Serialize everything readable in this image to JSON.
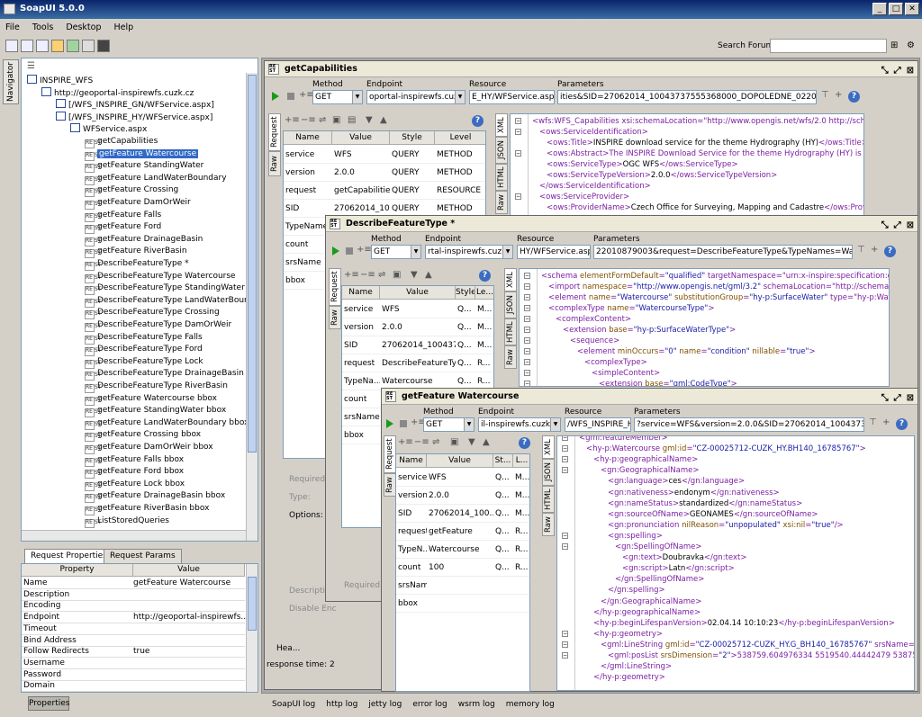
{
  "app": {
    "title": "SoapUI 5.0.0"
  },
  "menu": [
    "File",
    "Tools",
    "Desktop",
    "Help"
  ],
  "search": {
    "label": "Search Forum",
    "placeholder": ""
  },
  "navigator": {
    "tab_label": "Navigator"
  },
  "tree": [
    {
      "label": "INSPIRE_WFS",
      "indent": 0,
      "icon": "project-icon"
    },
    {
      "label": "http://geoportal-inspirewfs.cuzk.cz",
      "indent": 1,
      "icon": "interface-icon"
    },
    {
      "label": "[/WFS_INSPIRE_GN/WFService.aspx]",
      "indent": 2,
      "icon": "resource-icon"
    },
    {
      "label": "[/WFS_INSPIRE_HY/WFService.aspx]",
      "indent": 2,
      "icon": "resource-icon"
    },
    {
      "label": "WFService.aspx",
      "indent": 3,
      "icon": "get-method-icon"
    },
    {
      "label": "getCapabilities",
      "indent": 4,
      "icon": "rest-request-icon"
    },
    {
      "label": "getFeature Watercourse",
      "indent": 4,
      "icon": "rest-request-icon",
      "selected": true
    },
    {
      "label": "getFeature StandingWater",
      "indent": 4,
      "icon": "rest-request-icon"
    },
    {
      "label": "getFeature LandWaterBoundary",
      "indent": 4,
      "icon": "rest-request-icon"
    },
    {
      "label": "getFeature Crossing",
      "indent": 4,
      "icon": "rest-request-icon"
    },
    {
      "label": "getFeature DamOrWeir",
      "indent": 4,
      "icon": "rest-request-icon"
    },
    {
      "label": "getFeature Falls",
      "indent": 4,
      "icon": "rest-request-icon"
    },
    {
      "label": "getFeature Ford",
      "indent": 4,
      "icon": "rest-request-icon"
    },
    {
      "label": "getFeature DrainageBasin",
      "indent": 4,
      "icon": "rest-request-icon"
    },
    {
      "label": "getFeature RiverBasin",
      "indent": 4,
      "icon": "rest-request-icon"
    },
    {
      "label": "DescribeFeatureType *",
      "indent": 4,
      "icon": "rest-request-icon"
    },
    {
      "label": "DescribeFeatureType Watercourse",
      "indent": 4,
      "icon": "rest-request-icon"
    },
    {
      "label": "DescribeFeatureType StandingWater",
      "indent": 4,
      "icon": "rest-request-icon"
    },
    {
      "label": "DescribeFeatureType LandWaterBounda",
      "indent": 4,
      "icon": "rest-request-icon"
    },
    {
      "label": "DescribeFeatureType Crossing",
      "indent": 4,
      "icon": "rest-request-icon"
    },
    {
      "label": "DescribeFeatureType DamOrWeir",
      "indent": 4,
      "icon": "rest-request-icon"
    },
    {
      "label": "DescribeFeatureType Falls",
      "indent": 4,
      "icon": "rest-request-icon"
    },
    {
      "label": "DescribeFeatureType Ford",
      "indent": 4,
      "icon": "rest-request-icon"
    },
    {
      "label": "DescribeFeatureType Lock",
      "indent": 4,
      "icon": "rest-request-icon"
    },
    {
      "label": "DescribeFeatureType DrainageBasin",
      "indent": 4,
      "icon": "rest-request-icon"
    },
    {
      "label": "DescribeFeatureType RiverBasin",
      "indent": 4,
      "icon": "rest-request-icon"
    },
    {
      "label": "getFeature Watercourse bbox",
      "indent": 4,
      "icon": "rest-request-icon"
    },
    {
      "label": "getFeature StandingWater bbox",
      "indent": 4,
      "icon": "rest-request-icon"
    },
    {
      "label": "getFeature LandWaterBoundary bbox",
      "indent": 4,
      "icon": "rest-request-icon"
    },
    {
      "label": "getFeature Crossing bbox",
      "indent": 4,
      "icon": "rest-request-icon"
    },
    {
      "label": "getFeature DamOrWeir bbox",
      "indent": 4,
      "icon": "rest-request-icon"
    },
    {
      "label": "getFeature Falls bbox",
      "indent": 4,
      "icon": "rest-request-icon"
    },
    {
      "label": "getFeature Ford bbox",
      "indent": 4,
      "icon": "rest-request-icon"
    },
    {
      "label": "getFeature Lock bbox",
      "indent": 4,
      "icon": "rest-request-icon"
    },
    {
      "label": "getFeature DrainageBasin bbox",
      "indent": 4,
      "icon": "rest-request-icon"
    },
    {
      "label": "getFeature RiverBasin bbox",
      "indent": 4,
      "icon": "rest-request-icon"
    },
    {
      "label": "ListStoredQueries",
      "indent": 4,
      "icon": "rest-request-icon"
    }
  ],
  "props": {
    "tabs": [
      "Request Properties",
      "Request Params"
    ],
    "headers": [
      "Property",
      "Value"
    ],
    "rows": [
      [
        "Name",
        "getFeature Watercourse"
      ],
      [
        "Description",
        ""
      ],
      [
        "Encoding",
        ""
      ],
      [
        "Endpoint",
        "http://geoportal-inspirewfs...."
      ],
      [
        "Timeout",
        ""
      ],
      [
        "Bind Address",
        ""
      ],
      [
        "Follow Redirects",
        "true"
      ],
      [
        "Username",
        ""
      ],
      [
        "Password",
        ""
      ],
      [
        "Domain",
        ""
      ]
    ],
    "button": "Properties"
  },
  "logs": [
    "SoapUI log",
    "http log",
    "jetty log",
    "error log",
    "wsrm log",
    "memory log"
  ],
  "labels": {
    "method": "Method",
    "endpoint": "Endpoint",
    "resource": "Resource",
    "parameters": "Parameters",
    "request": "Request",
    "raw": "Raw",
    "xml": "XML",
    "json": "JSON",
    "html": "HTML",
    "name": "Name",
    "value": "Value",
    "style": "Style",
    "level": "Level",
    "required": "Required:",
    "type": "Type:",
    "options": "Options:",
    "description": "Description",
    "disable_enc": "Disable Enc",
    "heade": "Hea...",
    "response_time": "response time: 2"
  },
  "win1": {
    "title": "getCapabilities",
    "method": "GET",
    "endpoint": "oportal-inspirewfs.cuzk.",
    "resource": "E_HY/WFService.aspx",
    "parameters": "ities&SID=27062014_10043737555368000_DOPOLEDNE_022010879003",
    "params": [
      [
        "service",
        "WFS",
        "QUERY",
        "METHOD"
      ],
      [
        "version",
        "2.0.0",
        "QUERY",
        "METHOD"
      ],
      [
        "request",
        "getCapabilities",
        "QUERY",
        "RESOURCE"
      ],
      [
        "SID",
        "27062014_10...",
        "QUERY",
        "METHOD"
      ],
      [
        "TypeNames",
        "",
        "",
        ""
      ],
      [
        "count",
        "",
        "",
        ""
      ],
      [
        "srsName",
        "",
        "",
        ""
      ],
      [
        "bbox",
        "",
        "",
        ""
      ]
    ],
    "xml": [
      "<wfs:WFS_Capabilities xsi:schemaLocation=\"http://www.opengis.net/wfs/2.0 http://schemas.o",
      "<ows:ServiceIdentification>",
      "<ows:Title>INSPIRE download service for the theme Hydrography (HY)</ows:Title>",
      "<ows:Abstract>The INSPIRE Download Service for the theme Hydrography (HY) is the serv",
      "<ows:ServiceType>OGC WFS</ows:ServiceType>",
      "<ows:ServiceTypeVersion>2.0.0</ows:ServiceTypeVersion>",
      "</ows:ServiceIdentification>",
      "<ows:ServiceProvider>",
      "<ows:ProviderName>Czech Office for Surveying, Mapping and Cadastre</ows:ProviderNa"
    ]
  },
  "win2": {
    "title": "DescribeFeatureType *",
    "method": "GET",
    "endpoint": "rtal-inspirewfs.cuzk.c",
    "resource": "HY/WFService.aspx",
    "parameters": "22010879003&request=DescribeFeatureType&TypeNames=Watercourse",
    "headers": [
      "Name",
      "Value",
      "Style",
      "Le..."
    ],
    "params": [
      [
        "service",
        "WFS",
        "Q...",
        "M..."
      ],
      [
        "version",
        "2.0.0",
        "Q...",
        "M..."
      ],
      [
        "SID",
        "27062014_100437...",
        "Q...",
        "M..."
      ],
      [
        "request",
        "DescribeFeatureType",
        "Q...",
        "R..."
      ],
      [
        "TypeNa...",
        "Watercourse",
        "Q...",
        "R..."
      ],
      [
        "count",
        "",
        "",
        ""
      ],
      [
        "srsName",
        "",
        "",
        ""
      ],
      [
        "bbox",
        "",
        "",
        ""
      ]
    ],
    "xml": [
      "<schema elementFormDefault=\"qualified\" targetNamespace=\"urn:x-inspire:specification:gmlas:HydroPhy",
      "<import namespace=\"http://www.opengis.net/gml/3.2\" schemaLocation=\"http://schemas.opengis.net/",
      "<element name=\"Watercourse\" substitutionGroup=\"hy-p:SurfaceWater\" type=\"hy-p:WatercourseTyp",
      "<complexType name=\"WatercourseType\">",
      "<complexContent>",
      "<extension base=\"hy-p:SurfaceWaterType\">",
      "<sequence>",
      "<element minOccurs=\"0\" name=\"condition\" nillable=\"true\">",
      "<complexType>",
      "<simpleContent>",
      "<extension base=\"gml:CodeType\">"
    ]
  },
  "win3": {
    "title": "getFeature Watercourse",
    "method": "GET",
    "endpoint": "il-inspirewfs.cuzk.cz",
    "resource": "/WFS_INSPIRE_H",
    "parameters": "?service=WFS&version=2.0.0&SID=27062014_10043737555368",
    "headers": [
      "Name",
      "Value",
      "St...",
      "L..."
    ],
    "params": [
      [
        "service",
        "WFS",
        "Q...",
        "M..."
      ],
      [
        "version",
        "2.0.0",
        "Q...",
        "M..."
      ],
      [
        "SID",
        "27062014_100...",
        "Q...",
        "M..."
      ],
      [
        "request",
        "getFeature",
        "Q...",
        "R..."
      ],
      [
        "TypeN...",
        "Watercourse",
        "Q...",
        "R..."
      ],
      [
        "count",
        "100",
        "Q...",
        "R..."
      ],
      [
        "srsName",
        "",
        "",
        ""
      ],
      [
        "bbox",
        "",
        "",
        ""
      ]
    ],
    "xml": [
      "<gml:featureMember>",
      "<hy-p:Watercourse gml:id=\"CZ-00025712-CUZK_HY.BH140_16785767\">",
      "<hy-p:geographicalName>",
      "<gn:GeographicalName>",
      "<gn:language>ces</gn:language>",
      "<gn:nativeness>endonym</gn:nativeness>",
      "<gn:nameStatus>standardized</gn:nameStatus>",
      "<gn:sourceOfName>GEONAMES</gn:sourceOfName>",
      "<gn:pronunciation nilReason=\"unpopulated\" xsi:nil=\"true\"/>",
      "<gn:spelling>",
      "<gn:SpellingOfName>",
      "<gn:text>Doubravka</gn:text>",
      "<gn:script>Latn</gn:script>",
      "</gn:SpellingOfName>",
      "</gn:spelling>",
      "</gn:GeographicalName>",
      "</hy-p:geographicalName>",
      "<hy-p:beginLifespanVersion>02.04.14 10:10:23</hy-p:beginLifespanVersion>",
      "<hy-p:geometry>",
      "<gml:LineString gml:id=\"CZ-00025712-CUZK_HY.G_BH140_16785767\" srsName=\"urn:og",
      "<gml:posList srsDimension=\"2\">538759.604976334 5519540.44442479 538750.90187",
      "</gml:LineString>",
      "</hy-p:geometry>"
    ]
  }
}
